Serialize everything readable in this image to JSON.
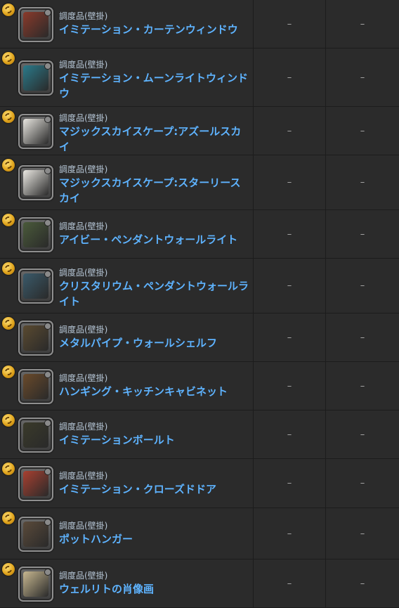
{
  "rows": [
    {
      "category": "調度品(壁掛)",
      "name": "イミテーション・カーテンウィンドウ",
      "col_a": "–",
      "col_b": "–",
      "pic": "#8a3a2a"
    },
    {
      "category": "調度品(壁掛)",
      "name": "イミテーション・ムーンライトウィンドウ",
      "col_a": "–",
      "col_b": "–",
      "pic": "#2a7a8a"
    },
    {
      "category": "調度品(壁掛)",
      "name": "マジックスカイスケープ:アズールスカイ",
      "col_a": "–",
      "col_b": "–",
      "pic": "#e8e6e0"
    },
    {
      "category": "調度品(壁掛)",
      "name": "マジックスカイスケープ:スターリースカイ",
      "col_a": "–",
      "col_b": "–",
      "pic": "#ebe9e3"
    },
    {
      "category": "調度品(壁掛)",
      "name": "アイビー・ペンダントウォールライト",
      "col_a": "–",
      "col_b": "–",
      "pic": "#4a5a3a"
    },
    {
      "category": "調度品(壁掛)",
      "name": "クリスタリウム・ペンダントウォールライト",
      "col_a": "–",
      "col_b": "–",
      "pic": "#3a5a6a"
    },
    {
      "category": "調度品(壁掛)",
      "name": "メタルパイプ・ウォールシェルフ",
      "col_a": "–",
      "col_b": "–",
      "pic": "#5a4a30"
    },
    {
      "category": "調度品(壁掛)",
      "name": "ハンギング・キッチンキャビネット",
      "col_a": "–",
      "col_b": "–",
      "pic": "#6a4a2a"
    },
    {
      "category": "調度品(壁掛)",
      "name": "イミテーションボールト",
      "col_a": "–",
      "col_b": "–",
      "pic": "#3a3a2a"
    },
    {
      "category": "調度品(壁掛)",
      "name": "イミテーション・クローズドドア",
      "col_a": "–",
      "col_b": "–",
      "pic": "#a84030"
    },
    {
      "category": "調度品(壁掛)",
      "name": "ポットハンガー",
      "col_a": "–",
      "col_b": "–",
      "pic": "#5a4a3a"
    },
    {
      "category": "調度品(壁掛)",
      "name": "ウェルリトの肖像画",
      "col_a": "–",
      "col_b": "–",
      "pic": "#c8b890"
    }
  ]
}
